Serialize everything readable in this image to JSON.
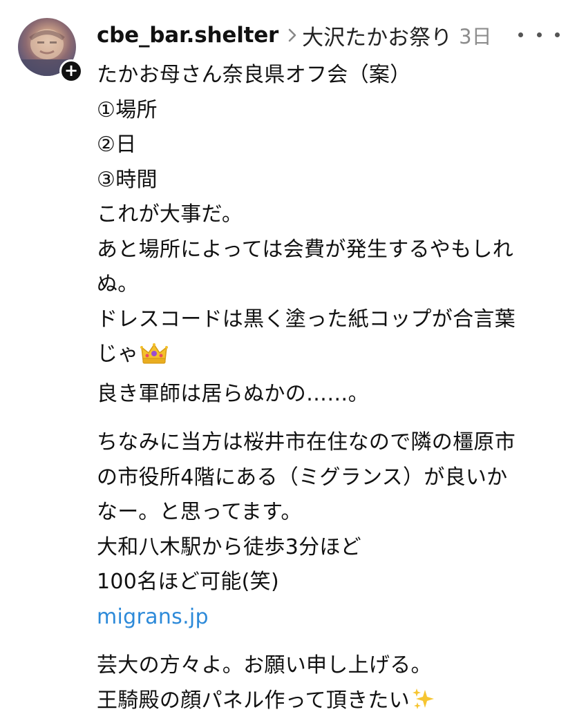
{
  "post": {
    "username": "cbe_bar.shelter",
    "topic": "大沢たかお祭り",
    "time": "3日",
    "follow_symbol": "+",
    "icons": {
      "chevron": "chevron-right-icon",
      "more": "more-options-icon",
      "crown": "crown-emoji-icon",
      "sparkles": "sparkles-emoji-icon"
    },
    "lines": {
      "l1": "たかお母さん奈良県オフ会（案）",
      "l2": "①場所",
      "l3": "②日",
      "l4": "③時間",
      "l5": "これが大事だ。",
      "l6": "あと場所によっては会費が発生するやもしれ",
      "l7": "ぬ。",
      "l8": "ドレスコードは黒く塗った紙コップが合言葉",
      "l9": "じゃ",
      "l10": "良き軍師は居らぬかの……。",
      "l11": "ちなみに当方は桜井市在住なので隣の橿原市",
      "l12": "の市役所4階にある（ミグランス）が良いか",
      "l13": "なー。と思ってます。",
      "l14": "大和八木駅から徒歩3分ほど",
      "l15": "100名ほど可能(笑)",
      "link": "migrans.jp",
      "l16": "芸大の方々よ。お願い申し上げる。",
      "l17": "王騎殿の顔パネル作って頂きたい"
    },
    "link_color": "#2d8ad9"
  }
}
